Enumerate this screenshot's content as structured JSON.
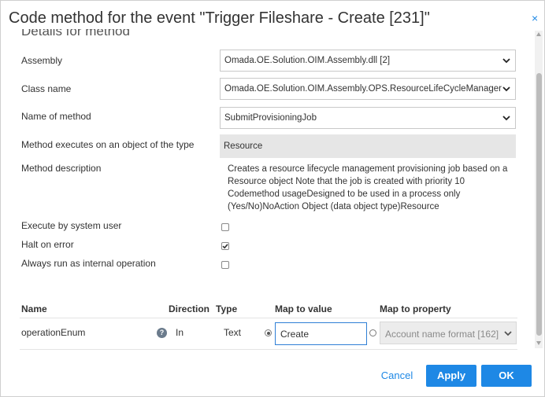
{
  "dialog": {
    "title": "Code method for the event \"Trigger Fileshare - Create [231]\"",
    "close_glyph": "×"
  },
  "section": {
    "heading": "Details for method"
  },
  "fields": {
    "assembly": {
      "label": "Assembly",
      "value": "Omada.OE.Solution.OIM.Assembly.dll [2]"
    },
    "class_name": {
      "label": "Class name",
      "value": "Omada.OE.Solution.OIM.Assembly.OPS.ResourceLifeCycleManager"
    },
    "method_name": {
      "label": "Name of method",
      "value": "SubmitProvisioningJob"
    },
    "object_type": {
      "label": "Method executes on an object of the type",
      "value": "Resource"
    },
    "description": {
      "label": "Method description",
      "value": "Creates a resource lifecycle management provisioning job based on a Resource object Note that the job is created with priority 10 Codemethod usageDesigned to be used in a process only (Yes/No)NoAction Object (data object type)Resource"
    },
    "execute_system_user": {
      "label": "Execute by system user",
      "checked": false
    },
    "halt_on_error": {
      "label": "Halt on error",
      "checked": true
    },
    "internal_operation": {
      "label": "Always run as internal operation",
      "checked": false
    }
  },
  "params_table": {
    "headers": {
      "name": "Name",
      "direction": "Direction",
      "type": "Type",
      "map_value": "Map to value",
      "map_property": "Map to property"
    },
    "rows": [
      {
        "name": "operationEnum",
        "help_glyph": "?",
        "direction": "In",
        "type": "Text",
        "map_value": "Create",
        "map_value_selected": true,
        "map_property": "Account name format [162]",
        "map_property_selected": false
      }
    ]
  },
  "footer": {
    "cancel_label": "Cancel",
    "apply_label": "Apply",
    "ok_label": "OK"
  },
  "colors": {
    "accent": "#1e88e5",
    "readonly_bg": "#e6e6e6",
    "disabled_bg": "#ececec"
  },
  "icons": {
    "close": "close-icon",
    "dropdown": "chevron-down-icon",
    "help": "help-icon",
    "checkbox_checked": "checkmark-icon"
  }
}
